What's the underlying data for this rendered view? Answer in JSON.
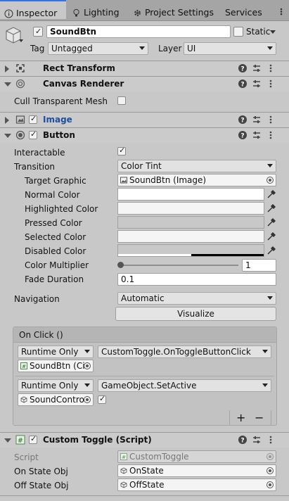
{
  "tabs": {
    "inspector": "Inspector",
    "lighting": "Lighting",
    "project_settings": "Project Settings",
    "services": "Services"
  },
  "object": {
    "name": "SoundBtn",
    "static_label": "Static",
    "tag_label": "Tag",
    "tag_value": "Untagged",
    "layer_label": "Layer",
    "layer_value": "UI"
  },
  "components": {
    "rect_transform": "Rect Transform",
    "canvas_renderer": "Canvas Renderer",
    "cull_transparent_mesh": "Cull Transparent Mesh",
    "image": "Image",
    "button": "Button"
  },
  "button": {
    "interactable_label": "Interactable",
    "transition_label": "Transition",
    "transition_value": "Color Tint",
    "target_graphic_label": "Target Graphic",
    "target_graphic_value": "SoundBtn (Image)",
    "normal_color": "Normal Color",
    "highlighted_color": "Highlighted Color",
    "pressed_color": "Pressed Color",
    "selected_color": "Selected Color",
    "disabled_color": "Disabled Color",
    "color_multiplier_label": "Color Multiplier",
    "color_multiplier_value": "1",
    "color_multiplier_fraction": 0.0,
    "fade_duration_label": "Fade Duration",
    "fade_duration_value": "0.1",
    "navigation_label": "Navigation",
    "navigation_value": "Automatic",
    "visualize": "Visualize"
  },
  "on_click": {
    "title": "On Click ()",
    "events": [
      {
        "mode": "Runtime Only",
        "function": "CustomToggle.OnToggleButtonClick",
        "object": "SoundBtn (Ci"
      },
      {
        "mode": "Runtime Only",
        "function": "GameObject.SetActive",
        "object": "SoundContro"
      }
    ],
    "plus": "+",
    "minus": "−"
  },
  "custom_toggle": {
    "title": "Custom Toggle (Script)",
    "script_label": "Script",
    "script_value": "CustomToggle",
    "on_state_label": "On State Obj",
    "on_state_value": "OnState",
    "off_state_label": "Off State Obj",
    "off_state_value": "OffState"
  },
  "colors": {
    "tab_active_accent": "#3a72d8",
    "image_title": "#1c4fa0",
    "panel_bg": "#c8c8c8"
  }
}
